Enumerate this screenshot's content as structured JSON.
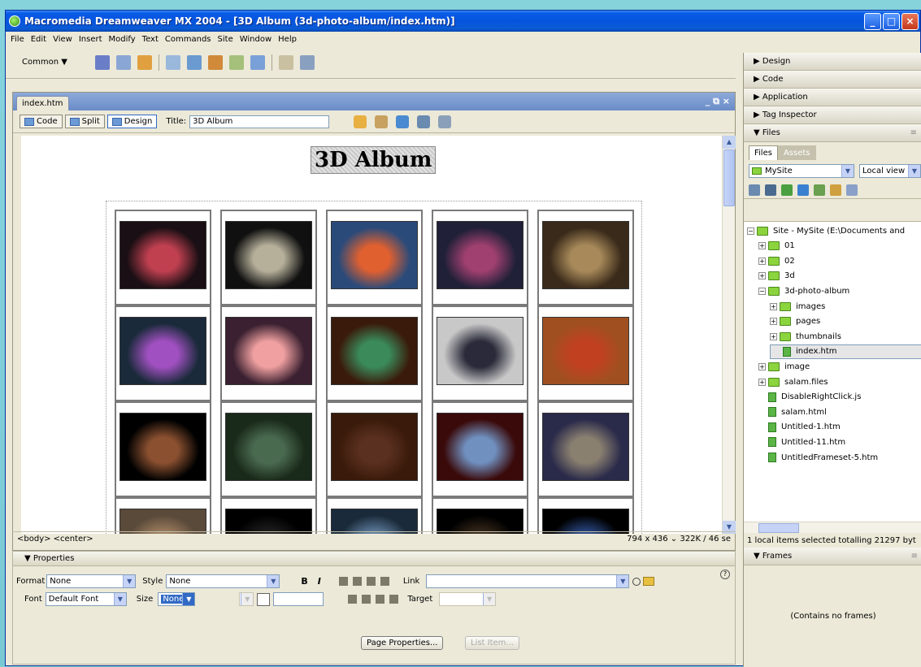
{
  "window": {
    "title": "Macromedia Dreamweaver MX 2004 - [3D Album (3d-photo-album/index.htm)]"
  },
  "menu": [
    "File",
    "Edit",
    "View",
    "Insert",
    "Modify",
    "Text",
    "Commands",
    "Site",
    "Window",
    "Help"
  ],
  "insert_bar": {
    "category": "Common ▼"
  },
  "document": {
    "tab": "index.htm",
    "controls": "_ ⧉ ×",
    "views": {
      "code": "Code",
      "split": "Split",
      "design": "Design"
    },
    "title_label": "Title:",
    "title_value": "3D Album"
  },
  "page": {
    "heading": "3D Album"
  },
  "thumbnails": [
    {
      "color": "#c04050",
      "bg": "#1a0f14"
    },
    {
      "color": "#b6b09a",
      "bg": "#101010"
    },
    {
      "color": "#e06030",
      "bg": "#2a4a7a"
    },
    {
      "color": "#a04070",
      "bg": "#202038"
    },
    {
      "color": "#a88a5a",
      "bg": "#3a2a1a"
    },
    {
      "color": "#a050c0",
      "bg": "#1a2a3a"
    },
    {
      "color": "#f0a0a0",
      "bg": "#3a2030"
    },
    {
      "color": "#3a8a5a",
      "bg": "#3a1a0a"
    },
    {
      "color": "#2a2a3a",
      "bg": "#c8c8c8"
    },
    {
      "color": "#c04020",
      "bg": "#a05020"
    },
    {
      "color": "#8a5030",
      "bg": "#000000"
    },
    {
      "color": "#4a6a50",
      "bg": "#1a2a1a"
    },
    {
      "color": "#5a3020",
      "bg": "#3a1a0a"
    },
    {
      "color": "#7090c0",
      "bg": "#3a0a0a"
    },
    {
      "color": "#8a8070",
      "bg": "#2a2a4a"
    },
    {
      "color": "#a08060",
      "bg": "#5a4a3a"
    },
    {
      "color": "#202020",
      "bg": "#000000"
    },
    {
      "color": "#6080a0",
      "bg": "#1a2a3a"
    },
    {
      "color": "#3a2a1a",
      "bg": "#000000"
    },
    {
      "color": "#2a4a8a",
      "bg": "#000000"
    }
  ],
  "status": {
    "tags": "<body> <center>",
    "size": "794 x 436 ⌄ 322K / 46 se"
  },
  "properties": {
    "header": "▼ Properties",
    "format_label": "Format",
    "format_value": "None",
    "style_label": "Style",
    "style_value": "None",
    "bold": "B",
    "italic": "I",
    "link_label": "Link",
    "font_label": "Font",
    "font_value": "Default Font",
    "size_label": "Size",
    "size_value": "None",
    "target_label": "Target",
    "page_properties": "Page Properties...",
    "list_item": "List Item..."
  },
  "panels": {
    "design": "▶ Design",
    "code": "▶ Code",
    "application": "▶ Application",
    "tag_inspector": "▶ Tag Inspector",
    "files": "▼ Files",
    "files_tab": "Files",
    "assets_tab": "Assets",
    "site_select": "MySite",
    "view_select": "Local view"
  },
  "tree": [
    {
      "label": "Site - MySite (E:\\Documents and",
      "type": "folder",
      "indent": 0,
      "pm": "−"
    },
    {
      "label": "01",
      "type": "folder",
      "indent": 1,
      "pm": "+"
    },
    {
      "label": "02",
      "type": "folder",
      "indent": 1,
      "pm": "+"
    },
    {
      "label": "3d",
      "type": "folder",
      "indent": 1,
      "pm": "+"
    },
    {
      "label": "3d-photo-album",
      "type": "folder",
      "indent": 1,
      "pm": "−"
    },
    {
      "label": "images",
      "type": "folder",
      "indent": 2,
      "pm": "+"
    },
    {
      "label": "pages",
      "type": "folder",
      "indent": 2,
      "pm": "+"
    },
    {
      "label": "thumbnails",
      "type": "folder",
      "indent": 2,
      "pm": "+"
    },
    {
      "label": "index.htm",
      "type": "file",
      "indent": 2,
      "pm": "",
      "selected": true
    },
    {
      "label": "image",
      "type": "folder",
      "indent": 1,
      "pm": "+"
    },
    {
      "label": "salam.files",
      "type": "folder",
      "indent": 1,
      "pm": "+"
    },
    {
      "label": "DisableRightClick.js",
      "type": "file",
      "indent": 1,
      "pm": ""
    },
    {
      "label": "salam.html",
      "type": "file",
      "indent": 1,
      "pm": ""
    },
    {
      "label": "Untitled-1.htm",
      "type": "file",
      "indent": 1,
      "pm": ""
    },
    {
      "label": "Untitled-11.htm",
      "type": "file",
      "indent": 1,
      "pm": ""
    },
    {
      "label": "UntitledFrameset-5.htm",
      "type": "file",
      "indent": 1,
      "pm": ""
    }
  ],
  "files_status": "1 local items selected totalling 21297 byt",
  "frames": {
    "header": "▼ Frames",
    "body": "(Contains no frames)"
  }
}
